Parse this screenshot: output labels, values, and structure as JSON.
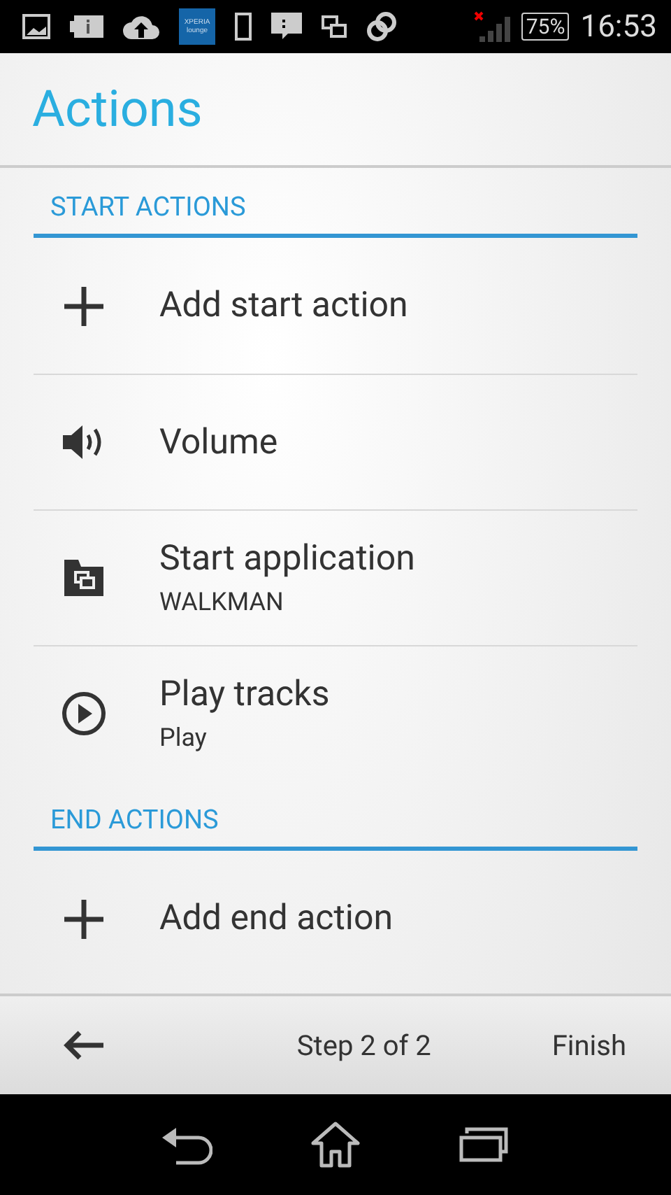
{
  "status_bar": {
    "logo": [
      "XPERIA",
      "lounge"
    ],
    "battery": "75%",
    "time": "16:53"
  },
  "title": "Actions",
  "sections": [
    {
      "header": "START ACTIONS",
      "items": [
        {
          "kind": "add",
          "title": "Add start action"
        },
        {
          "kind": "volume",
          "title": "Volume"
        },
        {
          "kind": "app",
          "title": "Start application",
          "subtitle": "WALKMAN"
        },
        {
          "kind": "play",
          "title": "Play tracks",
          "subtitle": "Play"
        }
      ]
    },
    {
      "header": "END ACTIONS",
      "items": [
        {
          "kind": "add",
          "title": "Add end action"
        }
      ]
    }
  ],
  "footer": {
    "step": "Step 2 of 2",
    "finish": "Finish"
  }
}
